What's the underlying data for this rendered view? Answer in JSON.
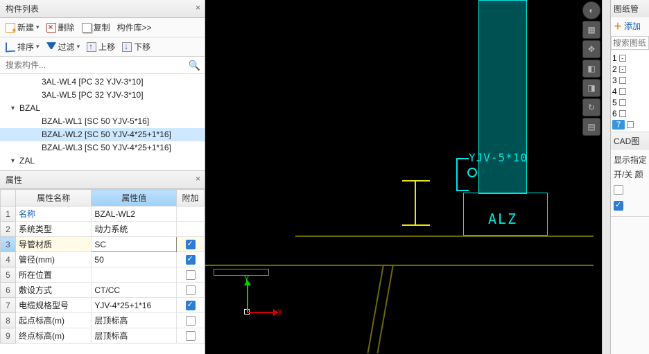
{
  "left": {
    "title": "构件列表",
    "toolbar1": {
      "new": "新建",
      "del": "删除",
      "copy": "复制",
      "lib": "构件库>>"
    },
    "toolbar2": {
      "sort": "排序",
      "filter": "过滤",
      "up": "上移",
      "down": "下移"
    },
    "search_placeholder": "搜索构件...",
    "tree": [
      {
        "level": 2,
        "label": "3AL-WL4 [PC 32 YJV-3*10]",
        "sel": false
      },
      {
        "level": 2,
        "label": "3AL-WL5 [PC 32 YJV-3*10]",
        "sel": false
      },
      {
        "level": 1,
        "label": "BZAL",
        "sel": false,
        "group": true
      },
      {
        "level": 2,
        "label": "BZAL-WL1 [SC 50 YJV-5*16]",
        "sel": false
      },
      {
        "level": 2,
        "label": "BZAL-WL2 [SC 50 YJV-4*25+1*16]",
        "sel": true
      },
      {
        "level": 2,
        "label": "BZAL-WL3 [SC 50 YJV-4*25+1*16]",
        "sel": false
      },
      {
        "level": 1,
        "label": "ZAL",
        "sel": false,
        "group": true
      }
    ]
  },
  "props": {
    "title": "属性",
    "col_name": "属性名称",
    "col_value": "属性值",
    "col_extra": "附加",
    "rows": [
      {
        "n": "1",
        "name": "名称",
        "value": "BZAL-WL2",
        "chk": null,
        "blue": true
      },
      {
        "n": "2",
        "name": "系统类型",
        "value": "动力系统",
        "chk": null
      },
      {
        "n": "3",
        "name": "导管材质",
        "value": "SC",
        "chk": true,
        "sel": true
      },
      {
        "n": "4",
        "name": "管径(mm)",
        "value": "50",
        "chk": true
      },
      {
        "n": "5",
        "name": "所在位置",
        "value": "",
        "chk": false
      },
      {
        "n": "6",
        "name": "敷设方式",
        "value": "CT/CC",
        "chk": false
      },
      {
        "n": "7",
        "name": "电缆规格型号",
        "value": "YJV-4*25+1*16",
        "chk": true
      },
      {
        "n": "8",
        "name": "起点标高(m)",
        "value": "层顶标高",
        "chk": false
      },
      {
        "n": "9",
        "name": "终点标高(m)",
        "value": "层顶标高",
        "chk": false
      }
    ]
  },
  "viewport": {
    "wire_label": "YJV-5*10",
    "box_label": "ALZ",
    "axis_x": "X",
    "axis_y": "Y"
  },
  "right": {
    "sec1_title": "图纸管",
    "add": "添加",
    "search_placeholder": "搜索图纸",
    "rows": [
      "1",
      "2",
      "3",
      "4",
      "5",
      "6",
      "7"
    ],
    "sec2_title": "CAD图",
    "lbl1": "显示指定",
    "lbl2": "开/关  颜"
  },
  "chart_data": null
}
